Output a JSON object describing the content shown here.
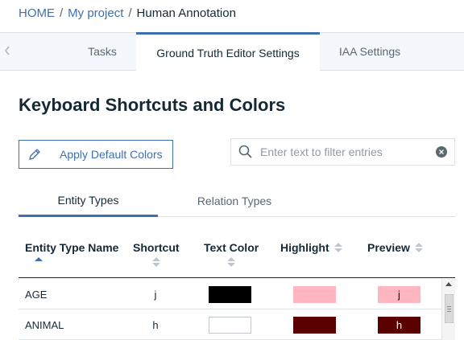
{
  "breadcrumb": {
    "home": "HOME",
    "sep": "/",
    "project": "My project",
    "current": "Human Annotation"
  },
  "tabs": [
    {
      "label": "Tasks",
      "active": false
    },
    {
      "label": "Ground Truth Editor Settings",
      "active": true
    },
    {
      "label": "IAA Settings",
      "active": false
    }
  ],
  "page": {
    "title": "Keyboard Shortcuts and Colors"
  },
  "toolbar": {
    "apply_default_label": "Apply Default Colors"
  },
  "search": {
    "placeholder": "Enter text to filter entries",
    "value": ""
  },
  "subtabs": [
    {
      "label": "Entity Types",
      "active": true
    },
    {
      "label": "Relation Types",
      "active": false
    }
  ],
  "table": {
    "columns": [
      "Entity Type Name",
      "Shortcut",
      "Text Color",
      "Highlight",
      "Preview"
    ],
    "sort_column": "Entity Type Name",
    "sort_direction": "ascending",
    "rows": [
      {
        "name": "AGE",
        "shortcut": "j",
        "text_color": "#000000",
        "highlight": "#ffb6c1",
        "preview_text": "j"
      },
      {
        "name": "ANIMAL",
        "shortcut": "h",
        "text_color": "#ffffff",
        "highlight": "#5a0000",
        "preview_text": "h"
      }
    ]
  },
  "colors": {
    "accent": "#3d70b2",
    "text": "#152935",
    "tabbar_bg": "#f4f7fb"
  }
}
